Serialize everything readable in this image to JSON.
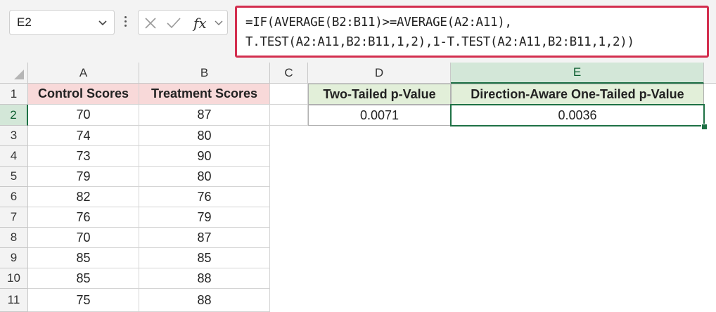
{
  "formula_bar": {
    "name_box": "E2",
    "formula_line1": "=IF(AVERAGE(B2:B11)>=AVERAGE(A2:A11),",
    "formula_line2": "T.TEST(A2:A11,B2:B11,1,2),1-T.TEST(A2:A11,B2:B11,1,2))"
  },
  "sheet": {
    "columns": [
      "A",
      "B",
      "C",
      "D",
      "E"
    ],
    "rows": [
      "1",
      "2",
      "3",
      "4",
      "5",
      "6",
      "7",
      "8",
      "9",
      "10",
      "11"
    ],
    "selected_cell": "E2",
    "headers": {
      "A": "Control Scores",
      "B": "Treatment Scores",
      "D": "Two-Tailed p-Value",
      "E": "Direction-Aware One-Tailed p-Value"
    },
    "control_scores": [
      "70",
      "74",
      "73",
      "79",
      "82",
      "76",
      "70",
      "85",
      "85",
      "75"
    ],
    "treatment_scores": [
      "87",
      "80",
      "90",
      "80",
      "76",
      "79",
      "87",
      "85",
      "88",
      "88"
    ],
    "two_tailed_p": "0.0071",
    "one_tailed_p": "0.0036"
  },
  "colors": {
    "accent_green": "#1e7145",
    "formula_highlight": "#d32f4f",
    "header_pink": "#f8d9d9",
    "header_green": "#e2efd9"
  }
}
